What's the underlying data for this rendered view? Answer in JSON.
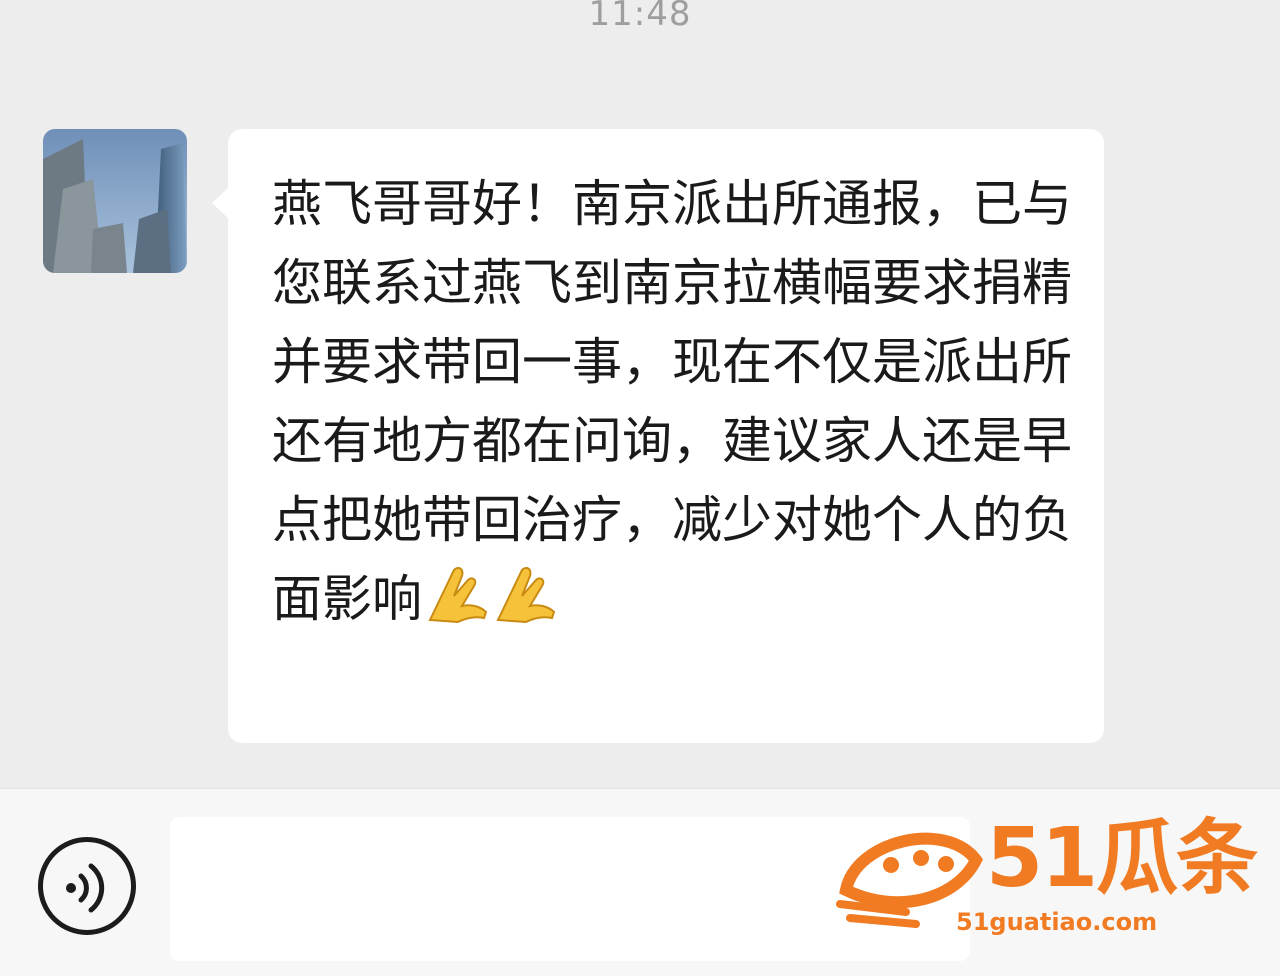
{
  "header": {
    "time": "11:48"
  },
  "message": {
    "sender_avatar": "building-avatar",
    "text": "燕飞哥哥好！南京派出所通报，已与您联系过燕飞到南京拉横幅要求捐精并要求带回一事，现在不仅是派出所还有地方都在问询，建议家人还是早点把她带回治疗，减少对她个人的负面影响",
    "emojis": [
      "folded-hands",
      "folded-hands"
    ]
  },
  "input_bar": {
    "voice_icon": "voice-icon",
    "input_value": ""
  },
  "watermark": {
    "brand": "51瓜条",
    "url": "51guatiao.com",
    "color": "#f07b22"
  },
  "colors": {
    "chat_bg": "#ededed",
    "bubble_bg": "#ffffff",
    "input_bar_bg": "#f7f7f7"
  }
}
